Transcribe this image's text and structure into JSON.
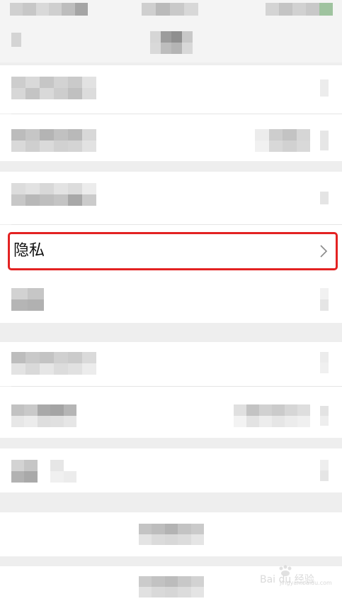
{
  "privacy_row": {
    "label": "隐私"
  },
  "watermark": {
    "brand": "Bai du 经验",
    "url": "jingyan.baidu.com"
  },
  "colors": {
    "highlight": "#e32222",
    "background": "#eeeeee",
    "row": "#ffffff"
  },
  "icons": {
    "chevron": "chevron-right-icon"
  }
}
